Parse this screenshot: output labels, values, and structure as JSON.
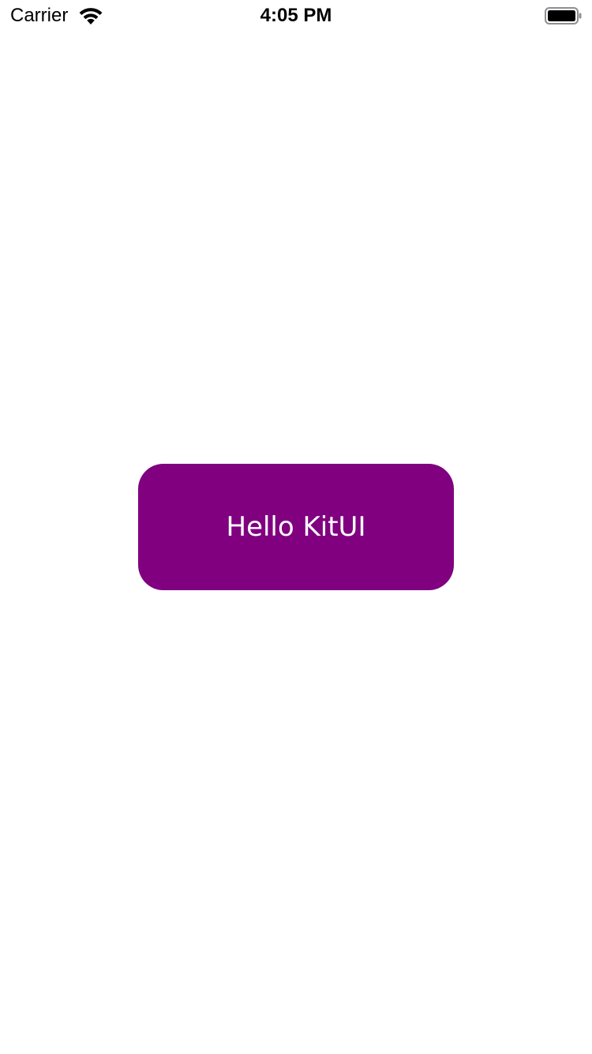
{
  "status_bar": {
    "carrier": "Carrier",
    "time": "4:05 PM",
    "icons": {
      "wifi": "wifi-icon",
      "battery": "battery-icon"
    },
    "battery_level": 1.0
  },
  "main": {
    "button_label": "Hello KitUI",
    "button_color": "#800080",
    "button_text_color": "#FFFFFF"
  },
  "colors": {
    "background": "#FFFFFF",
    "status_text": "#000000"
  }
}
